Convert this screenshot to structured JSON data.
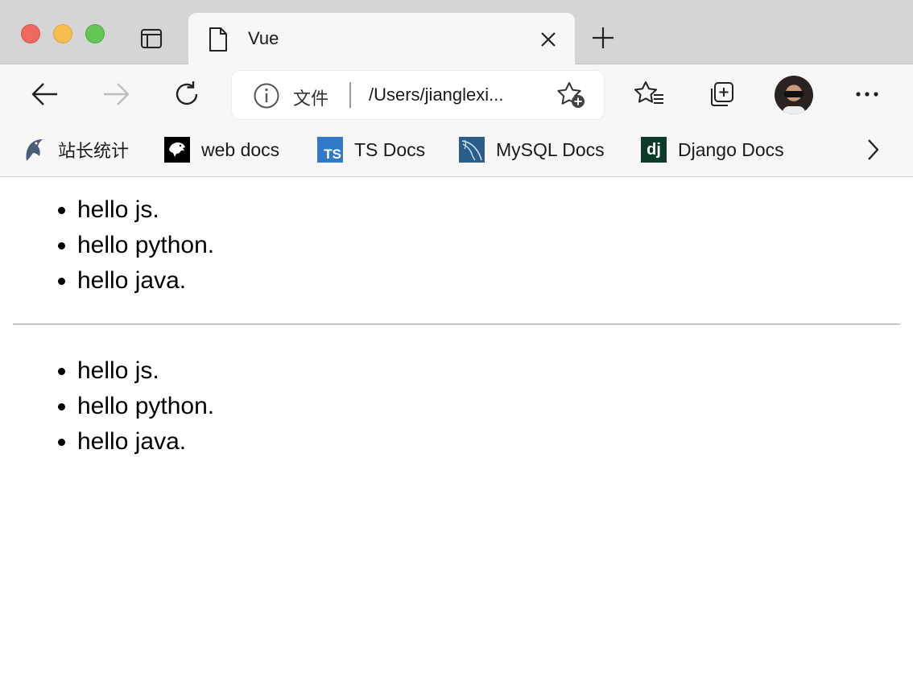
{
  "tab": {
    "title": "Vue"
  },
  "address": {
    "info_label": "文件",
    "url": "/Users/jianglexi..."
  },
  "bookmarks": [
    {
      "label": "站长统计",
      "icon": "dolphin-icon"
    },
    {
      "label": "web docs",
      "icon": "mdn-dino-icon"
    },
    {
      "label": "TS Docs",
      "icon": "ts-icon",
      "icon_text": "TS"
    },
    {
      "label": "MySQL Docs",
      "icon": "mysql-icon"
    },
    {
      "label": "Django Docs",
      "icon": "django-icon",
      "icon_text": "dj"
    }
  ],
  "list_one": [
    "hello js.",
    "hello python.",
    "hello java."
  ],
  "list_two": [
    "hello js.",
    "hello python.",
    "hello java."
  ],
  "colors": {
    "close": "#ee6a5f",
    "minimize": "#f5bf4f",
    "zoom": "#62c554",
    "ts_blue": "#3178c6",
    "django_green": "#0c3c26",
    "mysql_blue": "#2a5d8a"
  }
}
